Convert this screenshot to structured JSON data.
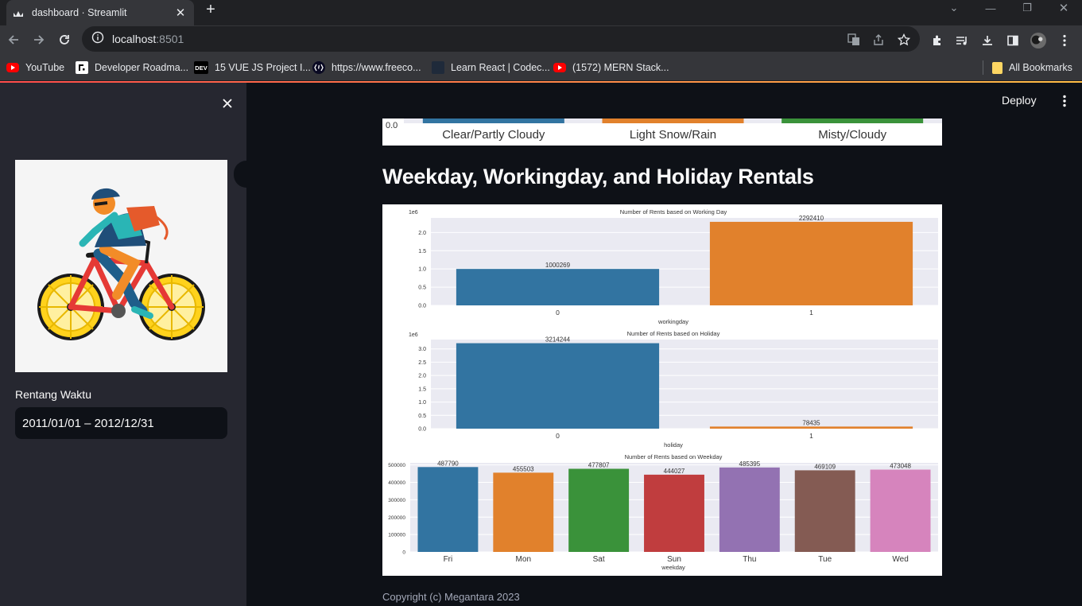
{
  "browser": {
    "tab_title": "dashboard · Streamlit",
    "url_host": "localhost",
    "url_port": ":8501",
    "bookmarks": [
      {
        "label": "YouTube",
        "icon": "youtube-icon"
      },
      {
        "label": "Developer Roadma...",
        "icon": "roadmap-icon"
      },
      {
        "label": "15 VUE JS Project I...",
        "icon": "dev-icon"
      },
      {
        "label": "https://www.freeco...",
        "icon": "freecodecamp-icon"
      },
      {
        "label": "Learn React | Codec...",
        "icon": "codecademy-icon"
      },
      {
        "label": "(1572) MERN Stack...",
        "icon": "youtube-icon"
      }
    ],
    "all_bookmarks": "All Bookmarks",
    "dev_badge": "DEV"
  },
  "sidebar": {
    "date_label": "Rentang Waktu",
    "date_value": "2011/01/01 – 2012/12/31",
    "image_icon": "cyclist-illustration"
  },
  "header": {
    "deploy_label": "Deploy"
  },
  "main": {
    "heading": "Weekday, Workingday, and Holiday Rentals",
    "copyright": "Copyright (c) Megantara 2023"
  },
  "colors": {
    "blue": "#3274a1",
    "orange": "#e1812c",
    "green": "#3a923a",
    "red": "#c03d3e",
    "purple": "#9372b2",
    "brown": "#845b53",
    "pink": "#d684bd",
    "plot_bg": "#eaeaf2"
  },
  "chart_data": [
    {
      "type": "bar",
      "partial": true,
      "categories": [
        "Clear/Partly Cloudy",
        "Light Snow/Rain",
        "Misty/Cloudy"
      ],
      "visible_tick": "0.0",
      "colors": [
        "#3274a1",
        "#e1812c",
        "#3a923a"
      ]
    },
    {
      "type": "bar",
      "title": "Number of Rents based on Working Day",
      "xlabel": "workingday",
      "ylabel": "",
      "offset_label": "1e6",
      "categories": [
        "0",
        "1"
      ],
      "values": [
        1000269,
        2292410
      ],
      "ylim": [
        0,
        2400000
      ],
      "yticks": [
        "0.0",
        "0.5",
        "1.0",
        "1.5",
        "2.0"
      ],
      "ytick_values": [
        0,
        500000,
        1000000,
        1500000,
        2000000
      ],
      "colors": [
        "#3274a1",
        "#e1812c"
      ]
    },
    {
      "type": "bar",
      "title": "Number of Rents based on Holiday",
      "xlabel": "holiday",
      "ylabel": "",
      "offset_label": "1e6",
      "categories": [
        "0",
        "1"
      ],
      "values": [
        3214244,
        78435
      ],
      "ylim": [
        0,
        3350000
      ],
      "yticks": [
        "0.0",
        "0.5",
        "1.0",
        "1.5",
        "2.0",
        "2.5",
        "3.0"
      ],
      "ytick_values": [
        0,
        500000,
        1000000,
        1500000,
        2000000,
        2500000,
        3000000
      ],
      "colors": [
        "#3274a1",
        "#e1812c"
      ]
    },
    {
      "type": "bar",
      "title": "Number of Rents based on Weekday",
      "xlabel": "weekday",
      "ylabel": "",
      "categories": [
        "Fri",
        "Mon",
        "Sat",
        "Sun",
        "Thu",
        "Tue",
        "Wed"
      ],
      "values": [
        487790,
        455503,
        477807,
        444027,
        485395,
        469109,
        473048
      ],
      "ylim": [
        0,
        512000
      ],
      "yticks": [
        "0",
        "100000",
        "200000",
        "300000",
        "400000",
        "500000"
      ],
      "ytick_values": [
        0,
        100000,
        200000,
        300000,
        400000,
        500000
      ],
      "colors": [
        "#3274a1",
        "#e1812c",
        "#3a923a",
        "#c03d3e",
        "#9372b2",
        "#845b53",
        "#d684bd"
      ]
    }
  ]
}
